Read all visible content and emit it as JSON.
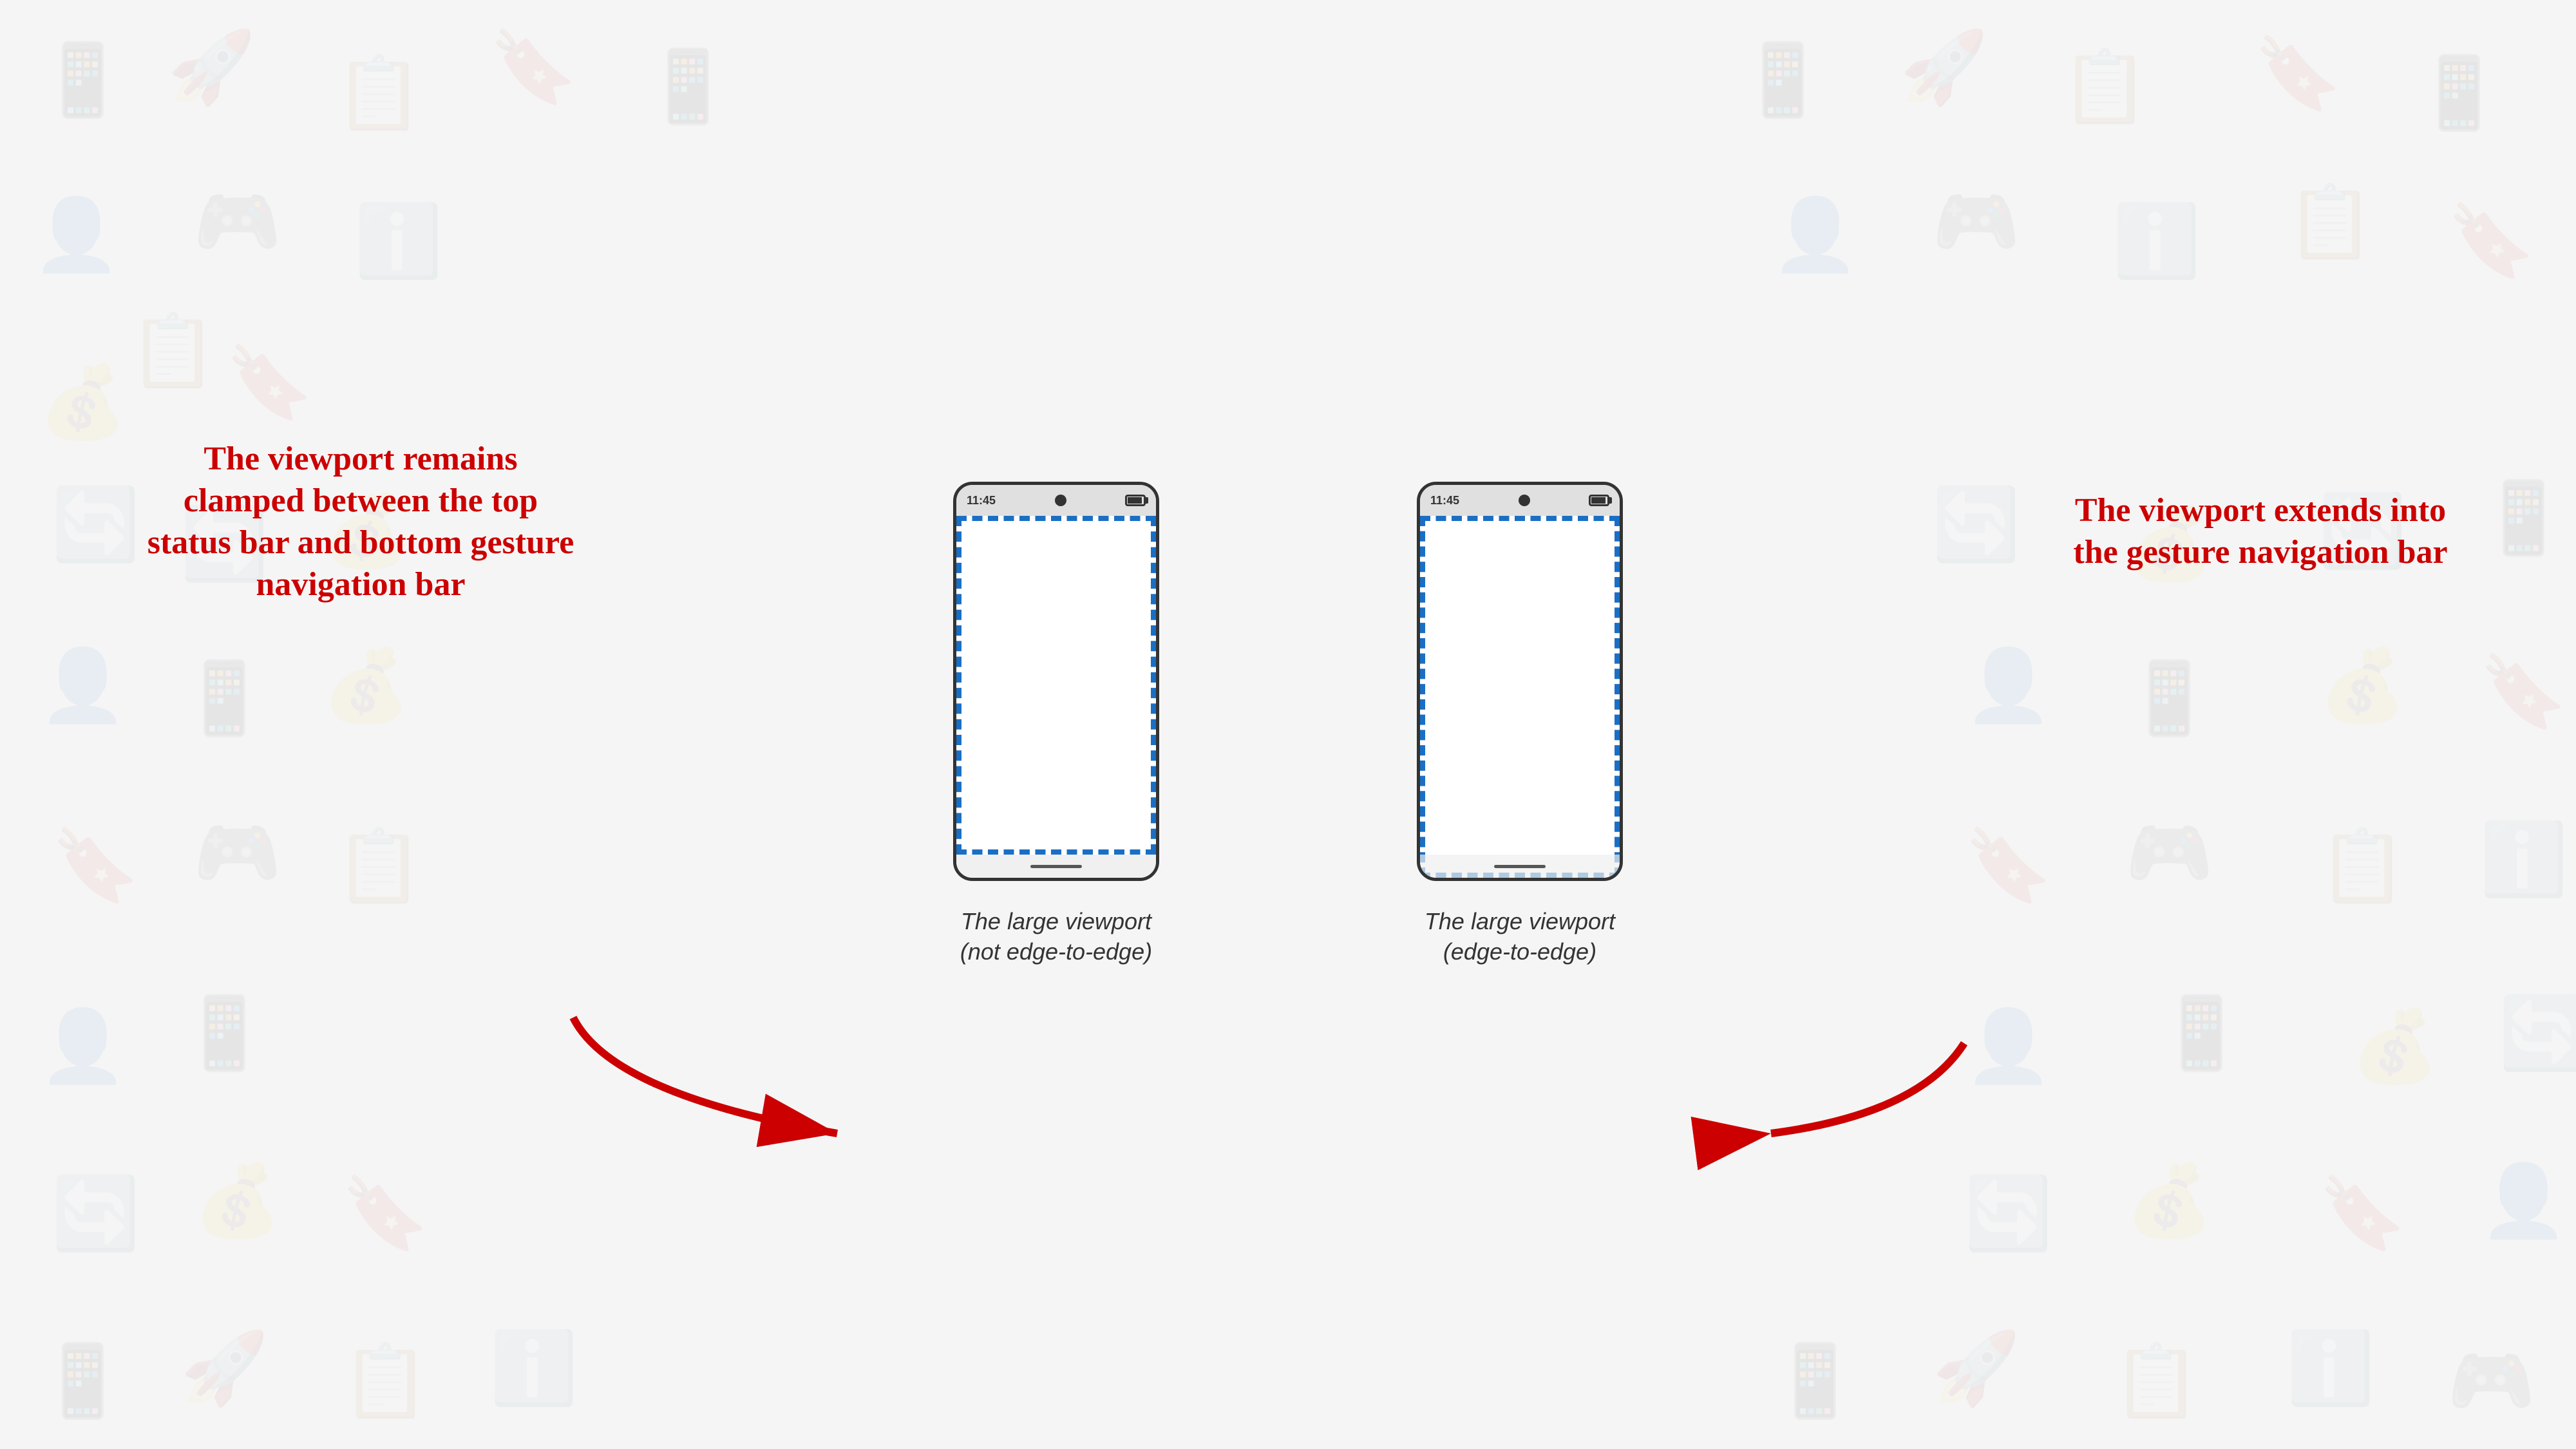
{
  "background": {
    "color": "#f5f5f5"
  },
  "phones": [
    {
      "id": "not-edge",
      "status_time": "11:45",
      "caption_line1": "The large viewport",
      "caption_line2": "(not edge-to-edge)",
      "type": "not-edge-to-edge"
    },
    {
      "id": "edge",
      "status_time": "11:45",
      "caption_line1": "The large viewport",
      "caption_line2": "(edge-to-edge)",
      "type": "edge-to-edge"
    }
  ],
  "annotations": {
    "left": {
      "text": "The viewport remains clamped between the top status bar and bottom gesture navigation bar"
    },
    "right": {
      "text": "The viewport extends into the gesture navigation bar"
    }
  },
  "colors": {
    "accent_red": "#cc0000",
    "dashed_border": "#1a6fc4",
    "phone_border": "#333333"
  }
}
